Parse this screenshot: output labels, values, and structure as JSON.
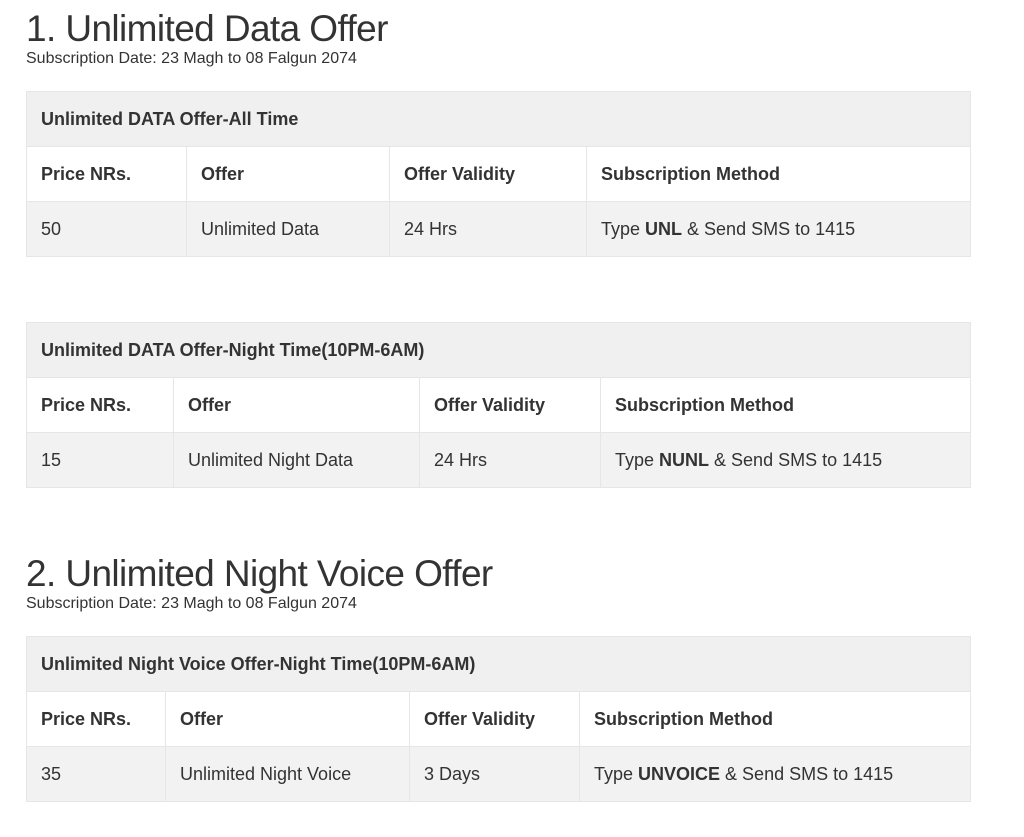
{
  "sections": [
    {
      "title": "1. Unlimited Data Offer",
      "subscription_date": "Subscription Date: 23 Magh to 08 Falgun 2074",
      "tables": [
        {
          "caption": "Unlimited DATA Offer-All Time",
          "headers": [
            "Price NRs.",
            "Offer",
            "Offer Validity",
            "Subscription Method"
          ],
          "row": {
            "price": "50",
            "offer": "Unlimited Data",
            "validity": "24 Hrs",
            "method_prefix": "Type ",
            "method_code": "UNL",
            "method_suffix": " & Send SMS to 1415"
          }
        },
        {
          "caption": "Unlimited DATA Offer-Night Time(10PM-6AM)",
          "headers": [
            "Price NRs.",
            "Offer",
            "Offer Validity",
            "Subscription Method"
          ],
          "row": {
            "price": "15",
            "offer": "Unlimited Night Data",
            "validity": "24 Hrs",
            "method_prefix": "Type ",
            "method_code": "NUNL",
            "method_suffix": " & Send SMS to 1415"
          }
        }
      ]
    },
    {
      "title": "2. Unlimited Night Voice Offer",
      "subscription_date": "Subscription Date: 23 Magh to 08 Falgun 2074",
      "tables": [
        {
          "caption": "Unlimited Night Voice Offer-Night Time(10PM-6AM)",
          "headers": [
            "Price NRs.",
            "Offer",
            "Offer Validity",
            "Subscription Method"
          ],
          "row": {
            "price": "35",
            "offer": "Unlimited Night Voice",
            "validity": "3 Days",
            "method_prefix": "Type ",
            "method_code": "UNVOICE",
            "method_suffix": " & Send SMS to 1415"
          }
        }
      ]
    }
  ]
}
